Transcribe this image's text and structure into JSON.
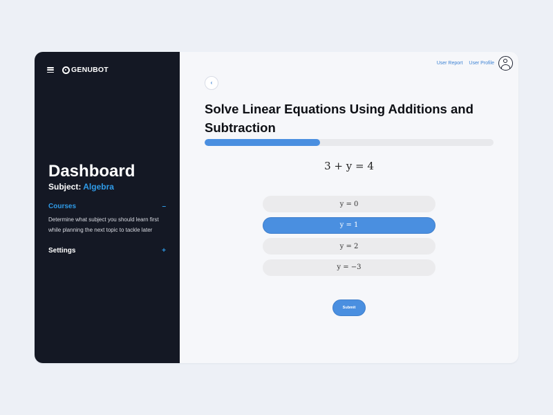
{
  "brand": {
    "logo_text": "GENUBOT"
  },
  "sidebar": {
    "title": "Dashboard",
    "subject_label": "Subject:",
    "subject_value": "Algebra",
    "sections": [
      {
        "label": "Courses",
        "toggle": "–",
        "description": "Determine what subject you should learn first while planning the next topic to tackle later",
        "expanded": true
      },
      {
        "label": "Settings",
        "toggle": "+",
        "expanded": false
      }
    ]
  },
  "header": {
    "links": [
      "User Report",
      "User Profile"
    ]
  },
  "lesson": {
    "back_glyph": "‹",
    "title": "Solve Linear Equations Using Additions and Subtraction",
    "progress_percent": 40,
    "equation": "3 + y = 4",
    "options": [
      {
        "label": "y = 0",
        "selected": false
      },
      {
        "label": "y = 1",
        "selected": true
      },
      {
        "label": "y = 2",
        "selected": false
      },
      {
        "label": "y = −3",
        "selected": false
      }
    ],
    "submit_label": "Submit"
  },
  "colors": {
    "sidebar_bg": "#141824",
    "accent": "#2f9be8",
    "primary_button": "#4a8fe0",
    "main_bg": "#f6f7fa",
    "page_bg": "#edf0f6"
  },
  "icons": [
    "hamburger-menu-icon",
    "genubot-logo-icon",
    "user-avatar-icon",
    "back-chevron-icon"
  ]
}
